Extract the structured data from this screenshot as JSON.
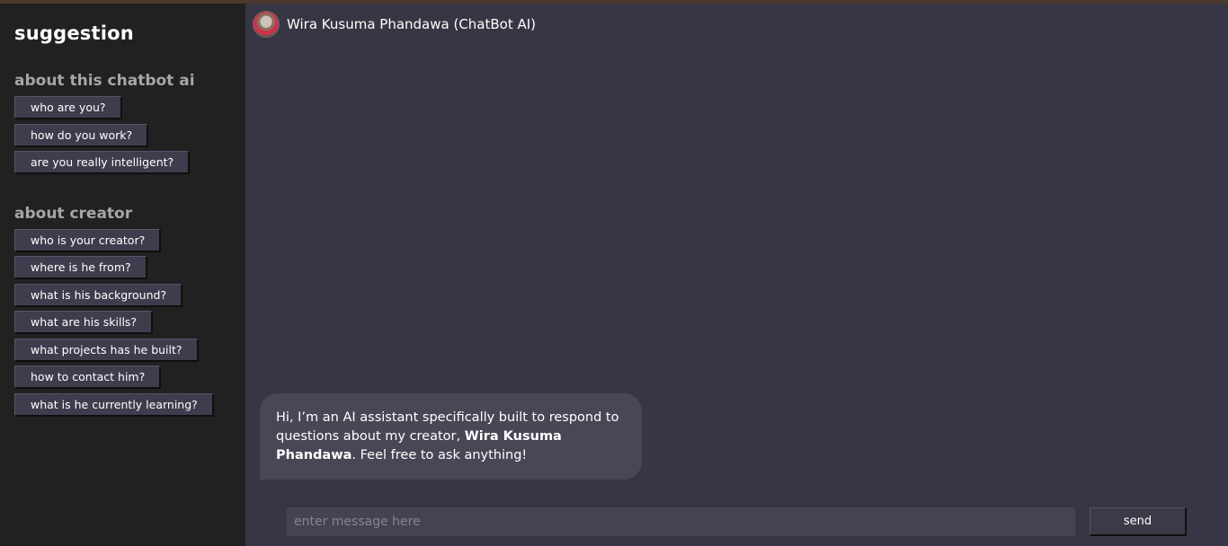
{
  "sidebar": {
    "title": "suggestion",
    "sections": [
      {
        "title": "about this chatbot ai",
        "items": [
          "who are you?",
          "how do you work?",
          "are you really intelligent?"
        ]
      },
      {
        "title": "about creator",
        "items": [
          "who is your creator?",
          "where is he from?",
          "what is his background?",
          "what are his skills?",
          "what projects has he built?",
          "how to contact him?",
          "what is he currently learning?"
        ]
      }
    ]
  },
  "chat": {
    "bot_name": "Wira Kusuma Phandawa (ChatBot AI)",
    "message": {
      "before": "Hi, I’m an AI assistant specifically built to respond to questions about my creator, ",
      "bold": "Wira Kusuma Phandawa",
      "after": ". Feel free to ask anything!"
    }
  },
  "composer": {
    "placeholder": "enter message here",
    "value": "",
    "send_label": "send"
  },
  "colors": {
    "sidebar_bg": "#212121",
    "main_bg": "#373644",
    "bubble_bg": "#484756",
    "button_bg": "#3e3d4d"
  }
}
